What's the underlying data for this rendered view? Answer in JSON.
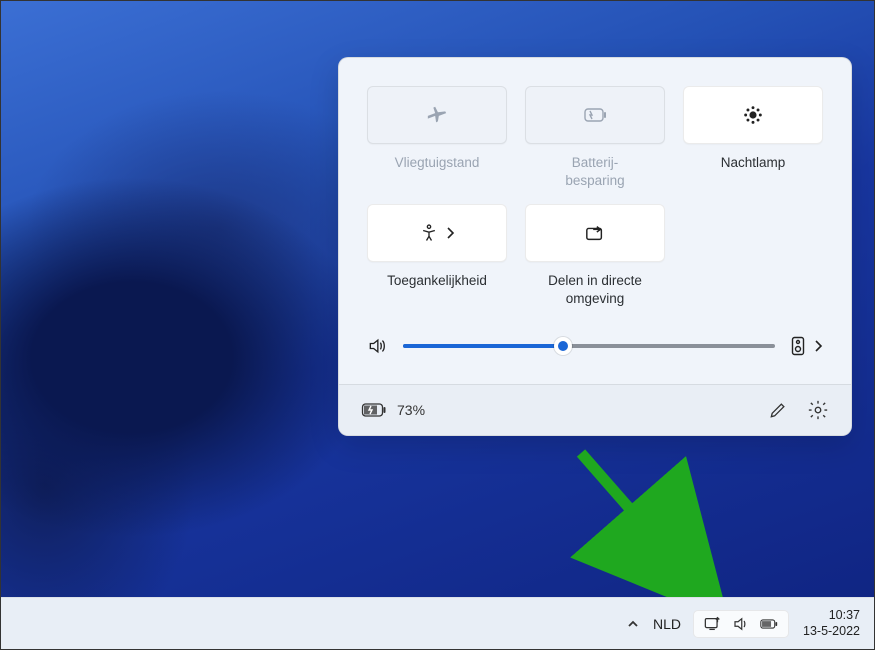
{
  "panel": {
    "tiles": [
      {
        "icon": "airplane-icon",
        "label": "Vliegtuigstand",
        "state": "disabled"
      },
      {
        "icon": "battery-saver-icon",
        "label": "Batterij-\nbesparing",
        "state": "disabled"
      },
      {
        "icon": "night-light-icon",
        "label": "Nachtlamp",
        "state": "active"
      },
      {
        "icon": "accessibility-icon",
        "label": "Toegankelijkheid",
        "state": "active",
        "chevron": true
      },
      {
        "icon": "cast-icon",
        "label": "Delen in directe omgeving",
        "state": "active"
      }
    ],
    "volume": {
      "value": 43
    },
    "battery": {
      "percent": "73%"
    }
  },
  "taskbar": {
    "language": "NLD",
    "time": "10:37",
    "date": "13-5-2022"
  }
}
